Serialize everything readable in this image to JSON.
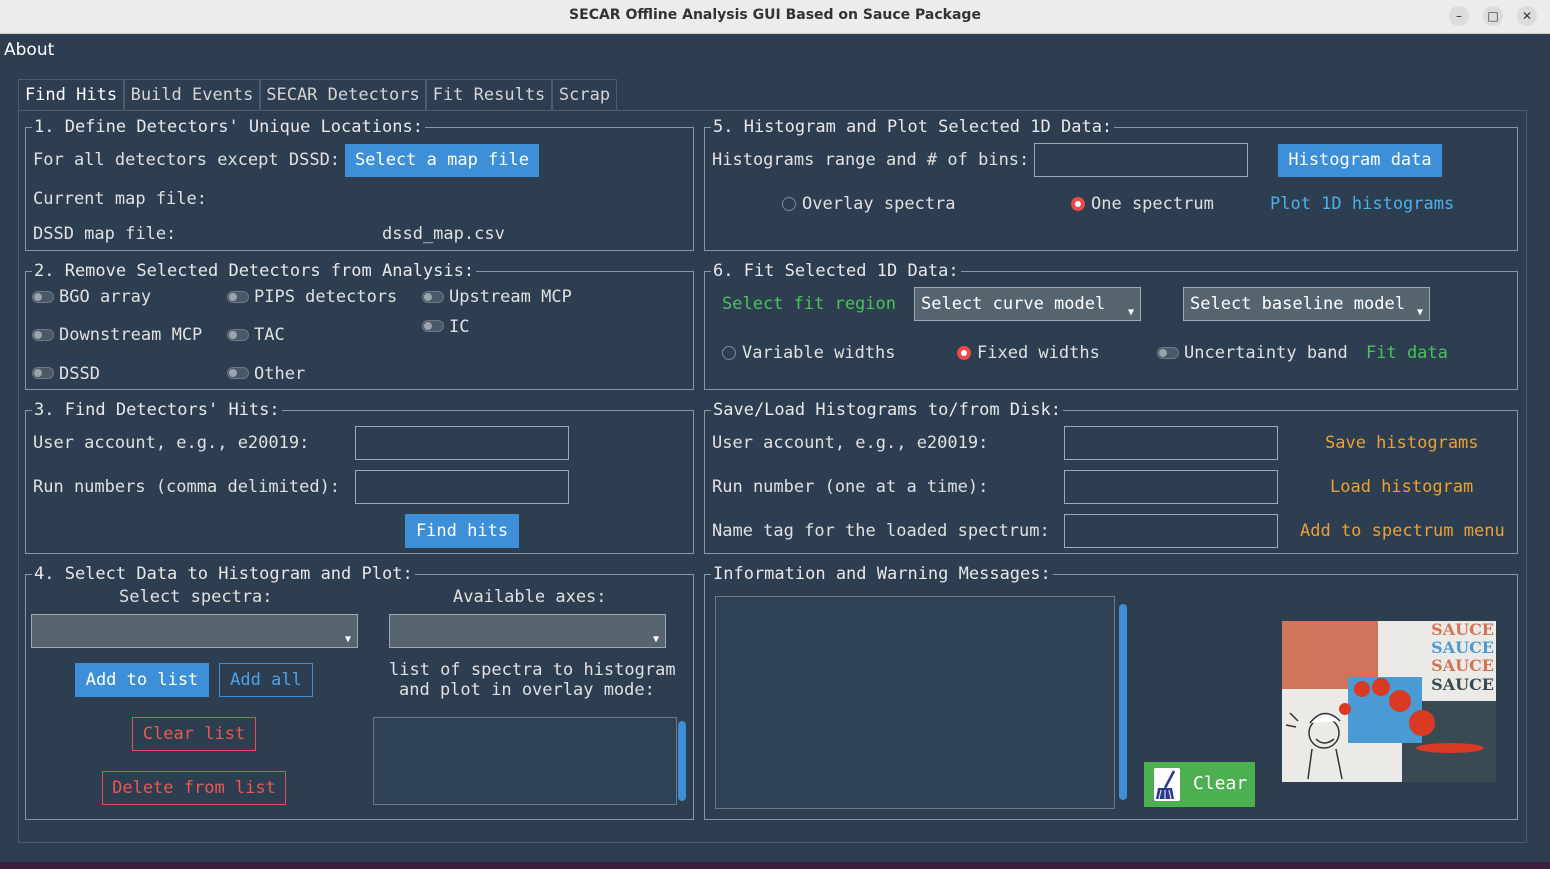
{
  "window": {
    "title": "SECAR Offline Analysis GUI Based on Sauce Package",
    "minimize": "–",
    "maximize": "□",
    "close": "✕"
  },
  "menu": {
    "about": "About"
  },
  "tabs": [
    "Find Hits",
    "Build Events",
    "SECAR Detectors",
    "Fit Results",
    "Scrap"
  ],
  "section1": {
    "title": "1. Define Detectors' Unique Locations:",
    "for_all_label": "For all detectors except DSSD:",
    "select_map_button": "Select a map file",
    "current_map_label": "Current map file:",
    "current_map_value": "",
    "dssd_map_label": "DSSD map file:",
    "dssd_map_value": "dssd_map.csv"
  },
  "section2": {
    "title": "2. Remove Selected Detectors from Analysis:",
    "detectors": [
      "BGO array",
      "PIPS detectors",
      "Upstream MCP",
      "Downstream MCP",
      "TAC",
      "IC",
      "DSSD",
      "Other"
    ]
  },
  "section3": {
    "title": "3. Find Detectors' Hits:",
    "user_label": "User account, e.g., e20019:",
    "user_value": "",
    "runs_label": "Run numbers (comma delimited):",
    "runs_value": "",
    "find_button": "Find hits"
  },
  "section4": {
    "title": "4. Select Data to Histogram and Plot:",
    "select_spectra_label": "Select spectra:",
    "available_axes_label": "Available axes:",
    "spectra_value": "",
    "axes_value": "",
    "add_to_list_button": "Add to list",
    "add_all_button": "Add all",
    "list_label_1": "list of spectra to histogram",
    "list_label_2": "and plot in overlay mode:",
    "clear_list_button": "Clear list",
    "delete_from_list_button": "Delete from list"
  },
  "section5": {
    "title": "5. Histogram and Plot Selected 1D Data:",
    "range_label": "Histograms range and # of bins:",
    "range_value": "",
    "histogram_button": "Histogram data",
    "overlay_label": "Overlay spectra",
    "one_spectrum_label": "One spectrum",
    "selected_mode": "One spectrum",
    "plot_link": "Plot 1D histograms"
  },
  "section6": {
    "title": "6. Fit Selected 1D Data:",
    "fit_region_link": "Select fit region",
    "curve_model": "Select curve model",
    "baseline_model": "Select baseline model",
    "variable_widths_label": "Variable widths",
    "fixed_widths_label": "Fixed widths",
    "selected_width": "Fixed widths",
    "uncertainty_label": "Uncertainty band",
    "fit_link": "Fit data"
  },
  "section_saveload": {
    "title": "Save/Load Histograms to/from Disk:",
    "user_label": "User account, e.g., e20019:",
    "user_value": "",
    "run_label": "Run number (one at a time):",
    "run_value": "",
    "tag_label": "Name tag for the loaded spectrum:",
    "tag_value": "",
    "save_link": "Save histograms",
    "load_link": "Load histogram",
    "add_link": "Add to spectrum menu"
  },
  "section_info": {
    "title": "Information and Warning Messages:",
    "messages": "",
    "clear_button": "Clear",
    "logo_words": [
      "SAUCE",
      "SAUCE",
      "SAUCE",
      "SAUCE"
    ]
  },
  "colors": {
    "background": "#2c3e50",
    "accent_blue": "#3d8fd8",
    "link_green": "#4cc25a",
    "link_orange": "#f0a030",
    "danger_red": "#e85a4f",
    "clear_green": "#4caf50"
  }
}
